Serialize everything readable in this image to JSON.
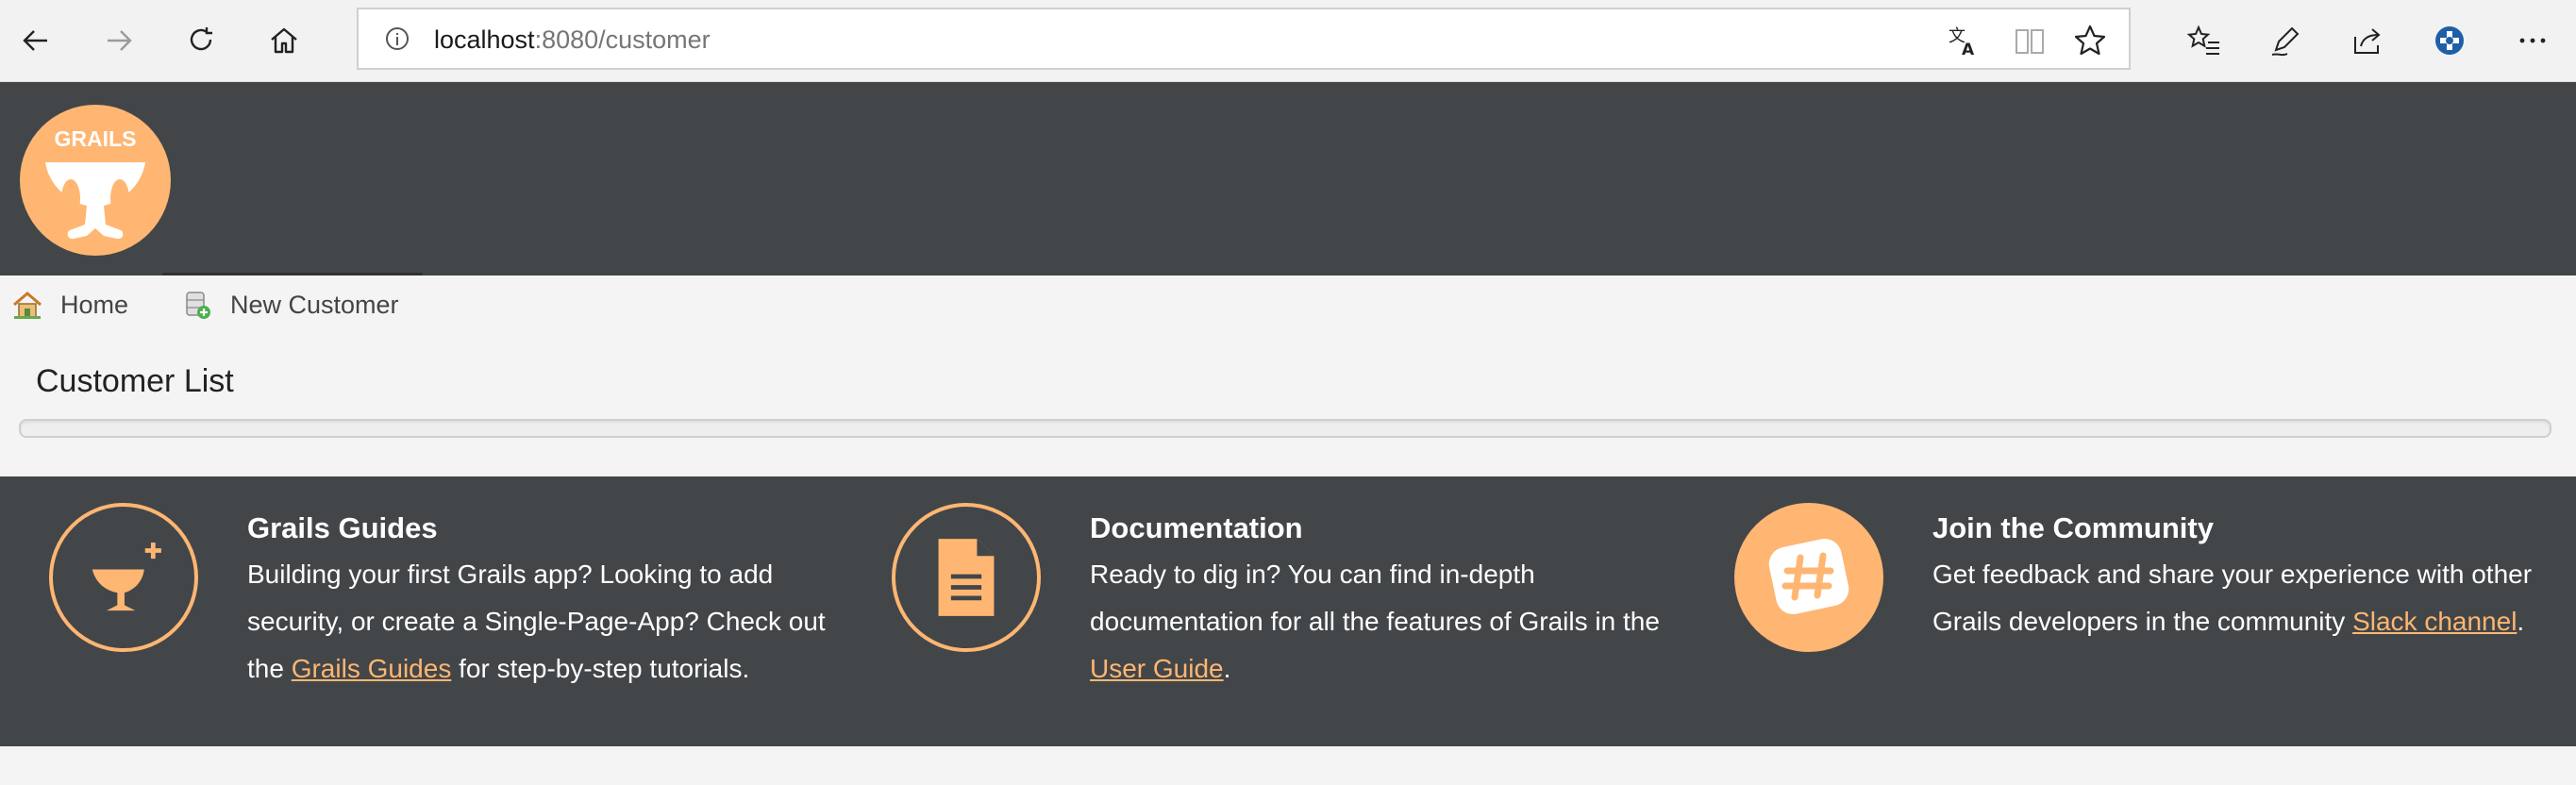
{
  "browser": {
    "url_host": "localhost",
    "url_path": ":8080/customer"
  },
  "header": {
    "logo_text": "GRAILS"
  },
  "nav": {
    "home_label": "Home",
    "new_customer_label": "New Customer"
  },
  "main": {
    "title": "Customer List"
  },
  "footer": {
    "guides": {
      "title": "Grails Guides",
      "text_before": "Building your first Grails app? Looking to add security, or create a Single-Page-App? Check out the ",
      "link": "Grails Guides",
      "text_after": " for step-by-step tutorials."
    },
    "docs": {
      "title": "Documentation",
      "text_before": "Ready to dig in? You can find in-depth documentation for all the features of Grails in the ",
      "link": "User Guide",
      "text_after": "."
    },
    "community": {
      "title": "Join the Community",
      "text_before": "Get feedback and share your experience with other Grails developers in the community ",
      "link": "Slack channel",
      "text_after": "."
    }
  },
  "colors": {
    "header_bg": "#424649",
    "accent": "#feb672",
    "page_bg": "#f4f4f4"
  },
  "icons": [
    "back-icon",
    "forward-icon",
    "refresh-icon",
    "home-icon",
    "site-info-icon",
    "translate-icon",
    "reading-view-icon",
    "favorite-star-icon",
    "favorites-list-icon",
    "pen-icon",
    "share-icon",
    "extension-icon",
    "more-icon",
    "grails-logo",
    "house-icon",
    "database-add-icon",
    "chalice-plus-icon",
    "document-icon",
    "slack-icon"
  ]
}
